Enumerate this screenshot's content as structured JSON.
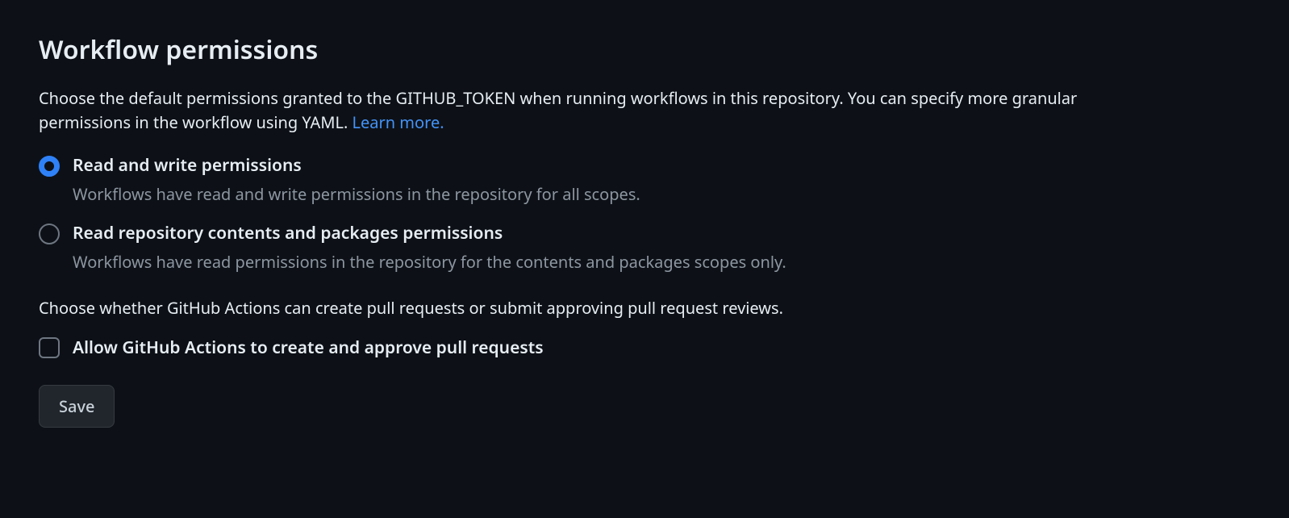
{
  "section": {
    "title": "Workflow permissions",
    "description_text": "Choose the default permissions granted to the GITHUB_TOKEN when running workflows in this repository. You can specify more granular permissions in the workflow using YAML. ",
    "learn_more_label": "Learn more."
  },
  "radio": {
    "options": [
      {
        "label": "Read and write permissions",
        "description": "Workflows have read and write permissions in the repository for all scopes.",
        "selected": true
      },
      {
        "label": "Read repository contents and packages permissions",
        "description": "Workflows have read permissions in the repository for the contents and packages scopes only.",
        "selected": false
      }
    ]
  },
  "secondary_description": "Choose whether GitHub Actions can create pull requests or submit approving pull request reviews.",
  "checkbox": {
    "label": "Allow GitHub Actions to create and approve pull requests",
    "checked": false
  },
  "save_button_label": "Save"
}
